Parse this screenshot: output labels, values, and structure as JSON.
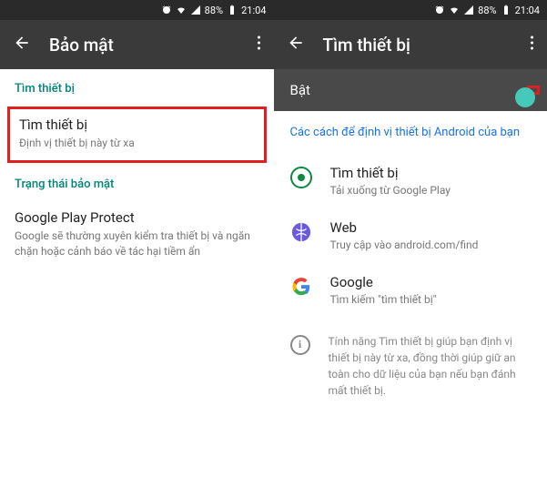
{
  "status": {
    "battery": "88%",
    "time": "21:04"
  },
  "left": {
    "title": "Bảo mật",
    "section1": "Tìm thiết bị",
    "item1_title": "Tìm thiết bị",
    "item1_sub": "Định vị thiết bị này từ xa",
    "section2": "Trạng thái bảo mật",
    "item2_title": "Google Play Protect",
    "item2_sub": "Google sẽ thường xuyên kiểm tra thiết bị và ngăn chặn hoặc cảnh báo về tác hại tiềm ẩn"
  },
  "right": {
    "title": "Tìm thiết bị",
    "toggle_label": "Bật",
    "toggle_on": true,
    "link": "Các cách để định vị thiết bị Android của bạn",
    "apps": [
      {
        "title": "Tìm thiết bị",
        "sub": "Tải xuống từ Google Play"
      },
      {
        "title": "Web",
        "sub": "Truy cập vào android.com/find"
      },
      {
        "title": "Google",
        "sub": "Tìm kiếm \"tìm thiết bị\""
      }
    ],
    "info": "Tính năng Tìm thiết bị giúp bạn định vị thiết bị này từ xa, đồng thời giúp giữ an toàn cho dữ liệu của bạn nếu bạn đánh mất thiết bị."
  }
}
